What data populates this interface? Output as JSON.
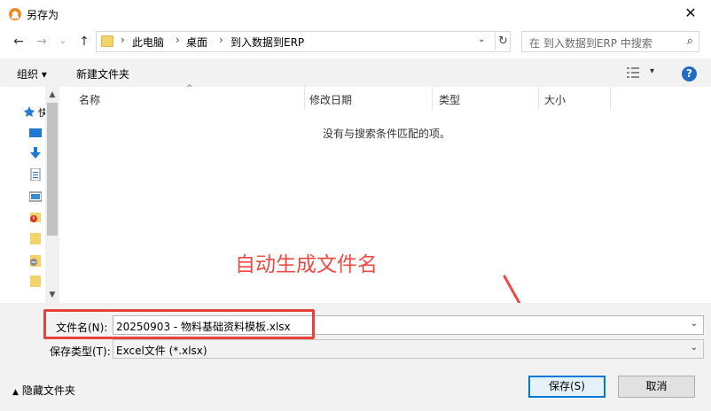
{
  "window": {
    "title": "另存为",
    "close": "✕"
  },
  "nav": {
    "back": "←",
    "forward": "→",
    "history": "⌄",
    "up": "↑",
    "breadcrumbs": [
      "此电脑",
      "桌面",
      "到入数据到ERP"
    ],
    "sep": "›",
    "dropdown": "⌄",
    "refresh": "↻",
    "search_placeholder": "在 到入数据到ERP 中搜索",
    "search_icon": "⌕"
  },
  "toolbar": {
    "organize": "组织 ▾",
    "new_folder": "新建文件夹",
    "view_dd": "▾",
    "help": "?"
  },
  "nav_pane": {
    "quick_access_label": "快",
    "icons": [
      "pin-icon",
      "desktop-icon",
      "download-icon",
      "document-icon",
      "picture-icon",
      "folder-alert-icon",
      "folder-icon",
      "folder-remove-icon",
      "folder-icon"
    ]
  },
  "list": {
    "columns": [
      "名称",
      "修改日期",
      "类型",
      "大小"
    ],
    "empty_message": "没有与搜索条件匹配的项。"
  },
  "annotation": "自动生成文件名",
  "form": {
    "filename_label": "文件名(N):",
    "filename_value": "20250903 - 物料基础资料模板.xlsx",
    "filetype_label": "保存类型(T):",
    "filetype_value": "Excel文件 (*.xlsx)",
    "dd": "⌄"
  },
  "footer": {
    "hide_folders": "隐藏文件夹",
    "hide_icon": "▲",
    "save": "保存(S)",
    "cancel": "取消"
  },
  "colors": {
    "accent": "#0078d7",
    "annotation": "#ef4a42"
  }
}
